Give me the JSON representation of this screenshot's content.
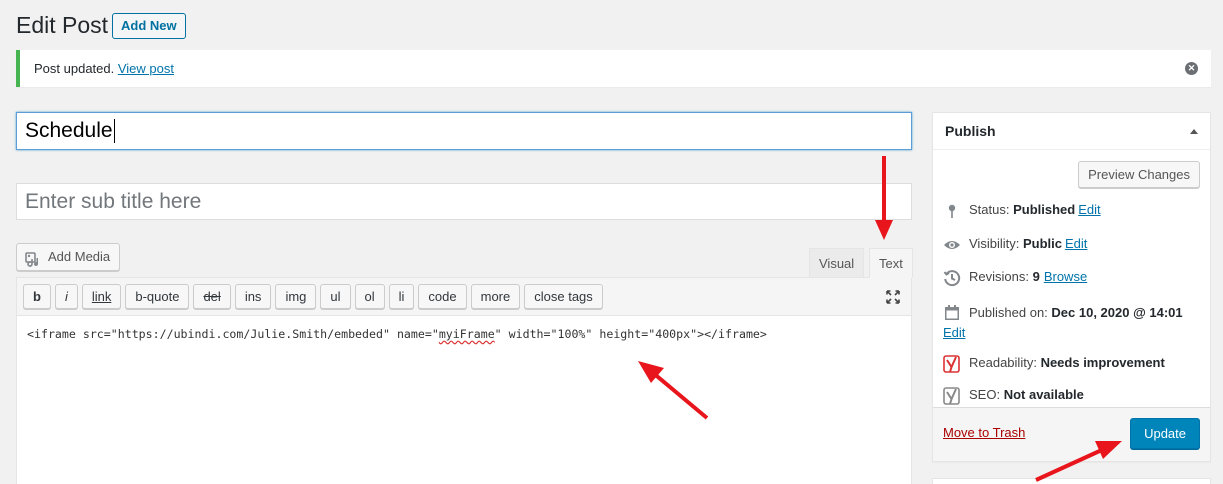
{
  "header": {
    "title": "Edit Post",
    "add_new_label": "Add New"
  },
  "notice": {
    "message": "Post updated.",
    "link_text": "View post"
  },
  "post": {
    "title_value": "Schedule",
    "subtitle_placeholder": "Enter sub title here"
  },
  "editor": {
    "add_media_label": "Add Media",
    "tabs": {
      "visual": "Visual",
      "text": "Text"
    },
    "quicktags": [
      "b",
      "i",
      "link",
      "b-quote",
      "del",
      "ins",
      "img",
      "ul",
      "ol",
      "li",
      "code",
      "more",
      "close tags"
    ],
    "content_pre": "<iframe src=\"https://ubindi.com/Julie.Smith/embeded\" name=\"",
    "content_spell": "myiFrame",
    "content_post": "\" width=\"100%\" height=\"400px\"></iframe>"
  },
  "publish": {
    "heading": "Publish",
    "preview_label": "Preview Changes",
    "status_label": "Status:",
    "status_value": "Published",
    "visibility_label": "Visibility:",
    "visibility_value": "Public",
    "revisions_label": "Revisions:",
    "revisions_value": "9",
    "published_label": "Published on:",
    "published_value": "Dec 10, 2020 @ 14:01",
    "readability_label": "Readability:",
    "readability_value": "Needs improvement",
    "seo_label": "SEO:",
    "seo_value": "Not available",
    "edit_link": "Edit",
    "browse_link": "Browse",
    "trash_label": "Move to Trash",
    "update_label": "Update"
  },
  "colors": {
    "accent": "#0073aa",
    "notice_border": "#46b450",
    "annotation_arrow": "#e8161c",
    "readability_status": "#dc3232"
  },
  "icons": [
    "close-icon",
    "media-icon",
    "fullscreen-icon",
    "pin-icon",
    "eye-icon",
    "history-icon",
    "calendar-icon",
    "yoast-icon",
    "triangle-up-icon"
  ]
}
